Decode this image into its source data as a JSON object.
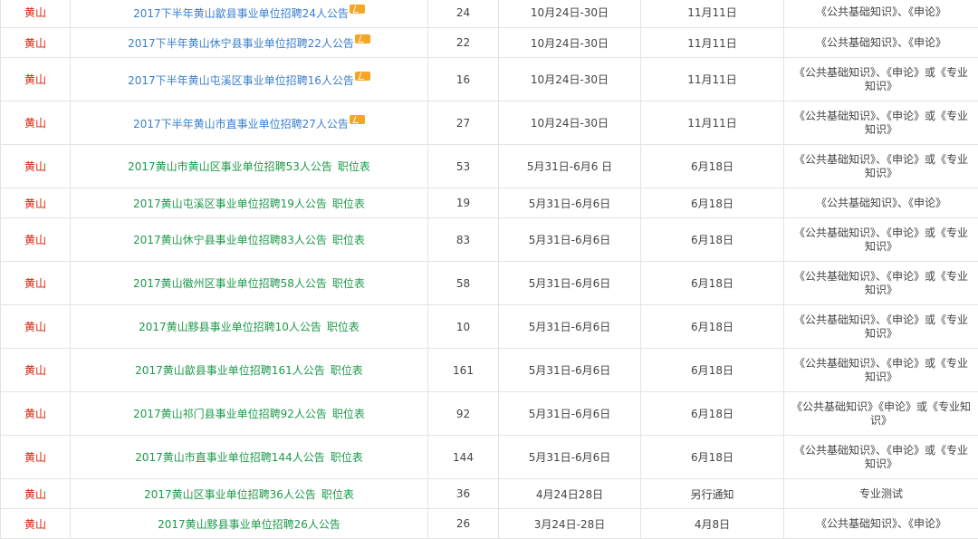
{
  "rows": [
    {
      "region": "黄山",
      "title": "2017下半年黄山歙县事业单位招聘24人公告",
      "title_color": "blue",
      "hot": true,
      "job_table": "",
      "count": "24",
      "signup": "10月24日-30日",
      "exam": "11月11日",
      "subject": "《公共基础知识》、《申论》"
    },
    {
      "region": "黄山",
      "title": "2017下半年黄山休宁县事业单位招聘22人公告",
      "title_color": "blue",
      "hot": true,
      "job_table": "",
      "count": "22",
      "signup": "10月24日-30日",
      "exam": "11月11日",
      "subject": "《公共基础知识》、《申论》"
    },
    {
      "region": "黄山",
      "title": "2017下半年黄山屯溪区事业单位招聘16人公告",
      "title_color": "blue",
      "hot": true,
      "job_table": "",
      "count": "16",
      "signup": "10月24日-30日",
      "exam": "11月11日",
      "subject": "《公共基础知识》、《申论》或《专业知识》"
    },
    {
      "region": "黄山",
      "title": "2017下半年黄山市直事业单位招聘27人公告",
      "title_color": "blue",
      "hot": true,
      "job_table": "",
      "count": "27",
      "signup": "10月24日-30日",
      "exam": "11月11日",
      "subject": "《公共基础知识》、《申论》或《专业知识》"
    },
    {
      "region": "黄山",
      "title": "2017黄山市黄山区事业单位招聘53人公告",
      "title_color": "green",
      "hot": false,
      "job_table": "职位表",
      "count": "53",
      "signup": "5月31日-6月6 日",
      "exam": "6月18日",
      "subject": "《公共基础知识》、《申论》或《专业知识》"
    },
    {
      "region": "黄山",
      "title": "2017黄山屯溪区事业单位招聘19人公告",
      "title_color": "green",
      "hot": false,
      "job_table": "职位表",
      "count": "19",
      "signup": "5月31日-6月6日",
      "exam": "6月18日",
      "subject": "《公共基础知识》、《申论》"
    },
    {
      "region": "黄山",
      "title": "2017黄山休宁县事业单位招聘83人公告",
      "title_color": "green",
      "hot": false,
      "job_table": "职位表",
      "count": "83",
      "signup": "5月31日-6月6日",
      "exam": "6月18日",
      "subject": "《公共基础知识》、《申论》或《专业知识》"
    },
    {
      "region": "黄山",
      "title": "2017黄山徽州区事业单位招聘58人公告",
      "title_color": "green",
      "hot": false,
      "job_table": "职位表",
      "count": "58",
      "signup": "5月31日-6月6日",
      "exam": "6月18日",
      "subject": "《公共基础知识》、《申论》或《专业知识》"
    },
    {
      "region": "黄山",
      "title": "2017黄山黟县事业单位招聘10人公告",
      "title_color": "green",
      "hot": false,
      "job_table": "职位表",
      "count": "10",
      "signup": "5月31日-6月6日",
      "exam": "6月18日",
      "subject": "《公共基础知识》、《申论》或《专业知识》"
    },
    {
      "region": "黄山",
      "title": "2017黄山歙县事业单位招聘161人公告",
      "title_color": "green",
      "hot": false,
      "job_table": "职位表",
      "count": "161",
      "signup": "5月31日-6月6日",
      "exam": "6月18日",
      "subject": "《公共基础知识》、《申论》或《专业知识》"
    },
    {
      "region": "黄山",
      "title": "2017黄山祁门县事业单位招聘92人公告",
      "title_color": "green",
      "hot": false,
      "job_table": "职位表",
      "count": "92",
      "signup": "5月31日-6月6日",
      "exam": "6月18日",
      "subject": "《公共基础知识》《申论》或《专业知识》"
    },
    {
      "region": "黄山",
      "title": "2017黄山市直事业单位招聘144人公告",
      "title_color": "green",
      "hot": false,
      "job_table": "职位表",
      "count": "144",
      "signup": "5月31日-6月6日",
      "exam": "6月18日",
      "subject": "《公共基础知识》、《申论》或《专业知识》"
    },
    {
      "region": "黄山",
      "title": "2017黄山区事业单位招聘36人公告",
      "title_color": "green",
      "hot": false,
      "job_table": "职位表",
      "count": "36",
      "signup": "4月24日28日",
      "exam": "另行通知",
      "subject": "专业测试"
    },
    {
      "region": "黄山",
      "title": "2017黄山黟县事业单位招聘26人公告",
      "title_color": "green",
      "hot": false,
      "job_table": "",
      "count": "26",
      "signup": "3月24日-28日",
      "exam": "4月8日",
      "subject": "《公共基础知识》、《申论》"
    }
  ]
}
